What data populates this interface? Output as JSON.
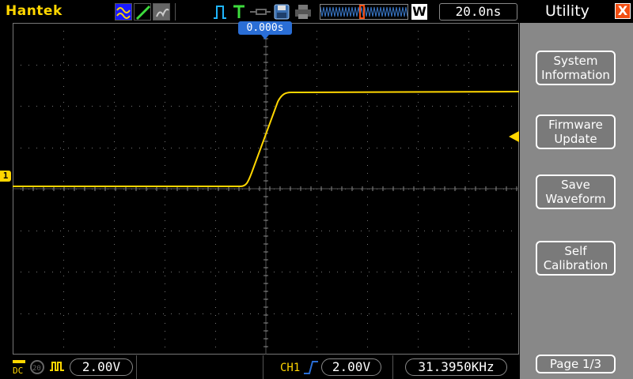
{
  "brand": "Hantek",
  "toolbar": {
    "wave_modes": [
      "waveform-icon",
      "line-icon",
      "persist-icon"
    ],
    "trigger_mode_icon": "pulse-trigger-icon",
    "trigger_state_icon": "T-icon",
    "probe_icon": "probe-icon",
    "save_icon": "floppy-disk-icon",
    "print_icon": "printer-icon"
  },
  "memory_window_label": "W",
  "timebase": "20.0ns",
  "trigger_position": "0.000s",
  "channel_marker": "1",
  "bottom": {
    "ch1_scale": "2.00V",
    "trigger_source": "CH1",
    "trigger_level": "2.00V",
    "frequency": "31.3950KHz",
    "coupling_icons": [
      "dc-icon",
      "bandwidth-20-icon",
      "invert-icon"
    ]
  },
  "sidebar": {
    "title": "Utility",
    "close_label": "X",
    "buttons": [
      {
        "line1": "System",
        "line2": "Information"
      },
      {
        "line1": "Firmware",
        "line2": "Update"
      },
      {
        "line1": "Save",
        "line2": "Waveform"
      },
      {
        "line1": "Self",
        "line2": "Calibration"
      }
    ],
    "page": "Page 1/3"
  },
  "colors": {
    "trace": "#ffd600",
    "accent": "#2a6ed6",
    "close": "#f24e12",
    "sidebar": "#888888"
  }
}
